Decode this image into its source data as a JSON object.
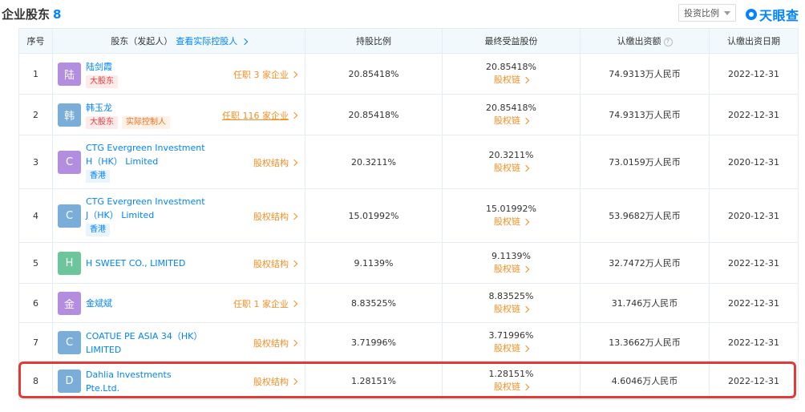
{
  "header": {
    "title": "企业股东",
    "count": "8",
    "ratio_label": "投资比例",
    "logo_text": "天眼查"
  },
  "columns": {
    "index": "序号",
    "holder": "股东（发起人）",
    "holder_link": "查看实际控股人",
    "ratio": "持股比例",
    "final": "最终受益股份",
    "capital": "认缴出资额",
    "date": "认缴出资日期"
  },
  "colors": {
    "accent": "#0084ff",
    "link_orange": "#f48f23",
    "header_bg": "#f2f9fc",
    "highlight": "#e53935"
  },
  "rows": [
    {
      "index": "1",
      "avatar": "陆",
      "avatar_color": "#b38ee0",
      "name": "陆剑霞",
      "tags": [
        {
          "text": "大股东",
          "style": "red"
        }
      ],
      "link": "任职 3 家企业",
      "link_underline": false,
      "ratio": "20.85418%",
      "final": "20.85418%",
      "chain": "股权链",
      "capital": "74.9313万人民币",
      "date": "2022-12-31"
    },
    {
      "index": "2",
      "avatar": "韩",
      "avatar_color": "#7aaed9",
      "name": "韩玉龙",
      "tags": [
        {
          "text": "大股东",
          "style": "red"
        },
        {
          "text": "实际控制人",
          "style": "orange"
        }
      ],
      "link": "任职 116 家企业",
      "link_underline": true,
      "ratio": "20.85418%",
      "final": "20.85418%",
      "chain": "股权链",
      "capital": "74.9313万人民币",
      "date": "2022-12-31"
    },
    {
      "index": "3",
      "avatar": "C",
      "avatar_color": "#b38ee0",
      "name": "CTG Evergreen Investment H（HK） Limited",
      "tags": [
        {
          "text": "香港",
          "style": "blue"
        }
      ],
      "link": "股权结构",
      "link_underline": false,
      "ratio": "20.3211%",
      "final": "20.3211%",
      "chain": "股权链",
      "capital": "73.0159万人民币",
      "date": "2020-12-31"
    },
    {
      "index": "4",
      "avatar": "C",
      "avatar_color": "#7aaed9",
      "name": "CTG Evergreen Investment J（HK） Limited",
      "tags": [
        {
          "text": "香港",
          "style": "blue"
        }
      ],
      "link": "股权结构",
      "link_underline": false,
      "ratio": "15.01992%",
      "final": "15.01992%",
      "chain": "股权链",
      "capital": "53.9682万人民币",
      "date": "2020-12-31"
    },
    {
      "index": "5",
      "avatar": "H",
      "avatar_color": "#6cc59b",
      "name": "H SWEET CO., LIMITED",
      "tags": [],
      "link": "股权结构",
      "link_underline": false,
      "ratio": "9.1139%",
      "final": "9.1139%",
      "chain": "股权链",
      "capital": "32.7472万人民币",
      "date": "2022-12-31"
    },
    {
      "index": "6",
      "avatar": "金",
      "avatar_color": "#b38ee0",
      "name": "金斌斌",
      "tags": [],
      "link": "任职 1 家企业",
      "link_underline": false,
      "ratio": "8.83525%",
      "final": "8.83525%",
      "chain": "股权链",
      "capital": "31.746万人民币",
      "date": "2022-12-31"
    },
    {
      "index": "7",
      "avatar": "C",
      "avatar_color": "#7aaed9",
      "name": "COATUE PE ASIA 34（HK） LIMITED",
      "tags": [],
      "link": "股权结构",
      "link_underline": false,
      "ratio": "3.71996%",
      "final": "3.71996%",
      "chain": "股权链",
      "capital": "13.3662万人民币",
      "date": "2022-12-31"
    },
    {
      "index": "8",
      "avatar": "D",
      "avatar_color": "#7aaed9",
      "name": "Dahlia Investments Pte.Ltd.",
      "tags": [],
      "link": "股权结构",
      "link_underline": false,
      "ratio": "1.28151%",
      "final": "1.28151%",
      "chain": "股权链",
      "capital": "4.6046万人民币",
      "date": "2022-12-31"
    }
  ]
}
